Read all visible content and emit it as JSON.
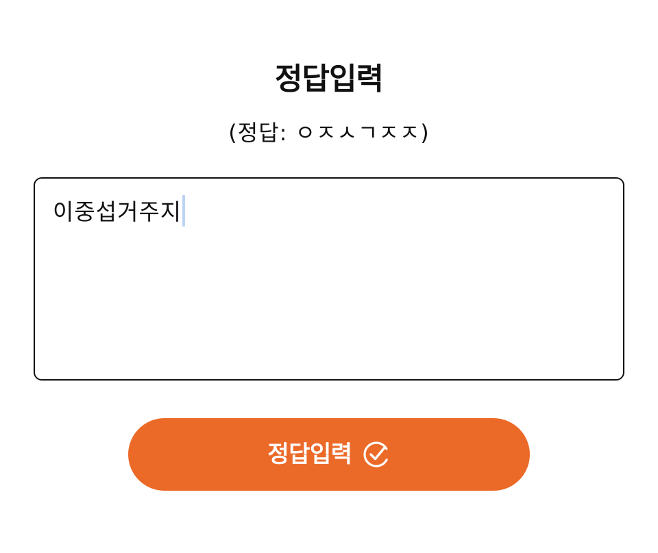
{
  "header": {
    "title": "정답입력",
    "hint": "(정답: ㅇㅈㅅㄱㅈㅈ)"
  },
  "answer": {
    "value": "이중섭거주지"
  },
  "submit": {
    "label": "정답입력",
    "icon": "check-circle-icon"
  },
  "colors": {
    "accent": "#eb6a28",
    "text": "#111111",
    "caret": "#bcd4f3"
  }
}
